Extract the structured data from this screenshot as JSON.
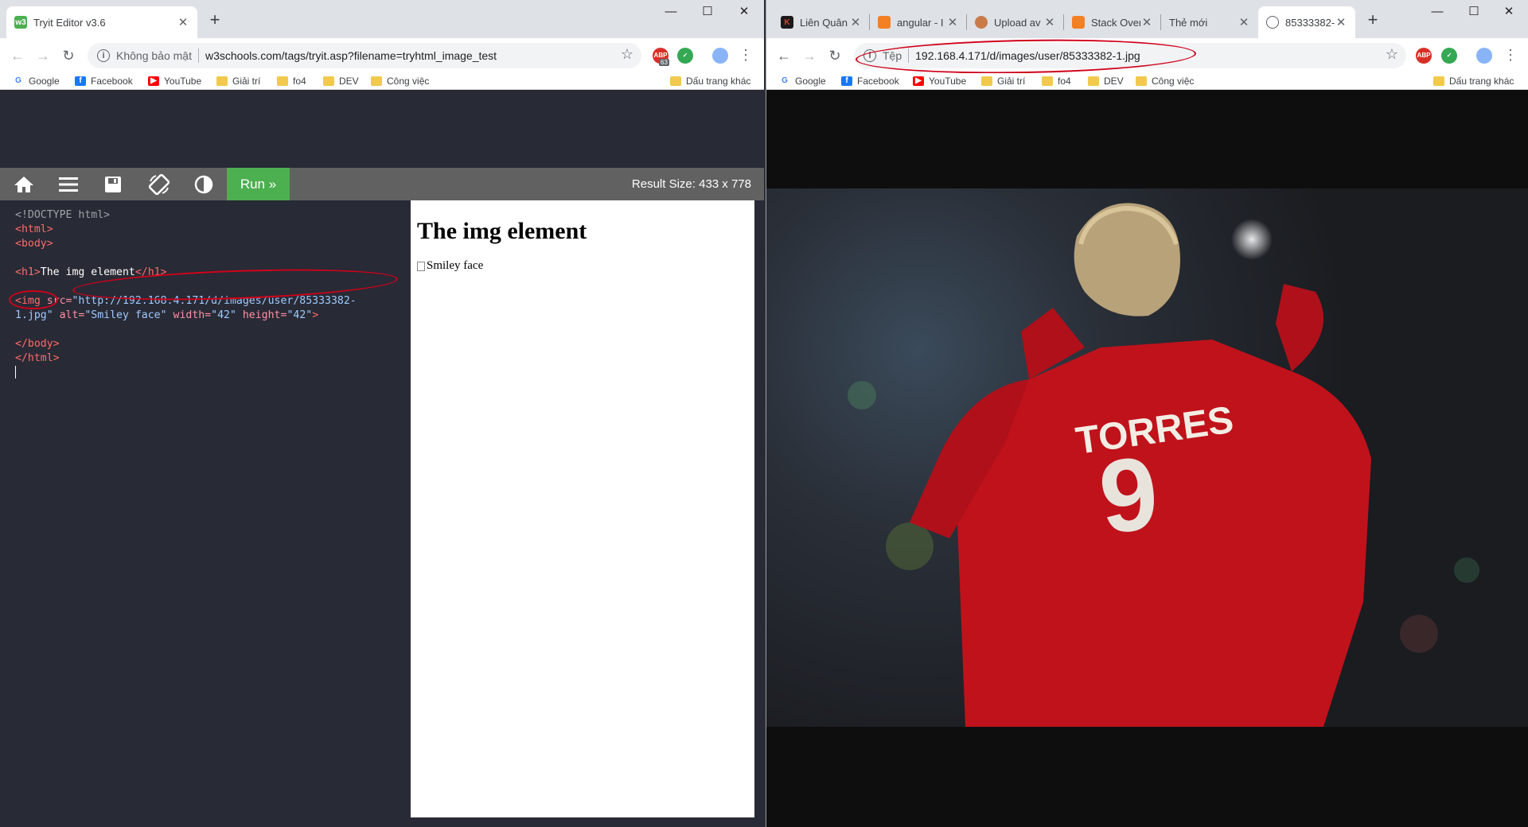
{
  "left": {
    "tab_title": "Tryit Editor v3.6",
    "tab_favicon": "w3",
    "address": {
      "security": "Không bảo mật",
      "url": "w3schools.com/tags/tryit.asp?filename=tryhtml_image_test"
    },
    "ext_badge": "63",
    "bookmarks": [
      "Google",
      "Facebook",
      "YouTube",
      "Giải trí",
      "fo4",
      "DEV",
      "Công việc"
    ],
    "other_bookmarks": "Dấu trang khác",
    "tryit": {
      "run_label": "Run »",
      "result_size_label": "Result Size: 433  x  778",
      "code": {
        "l1": "<!DOCTYPE html>",
        "l2": "<html>",
        "l3": "<body>",
        "l5_open": "<h1>",
        "l5_text": "The img element",
        "l5_close": "</h1>",
        "l7_tag": "<img",
        "l7_attr_src": " src=",
        "l7_val_src": "\"http://192.168.4.171/d/images/user/85333382-",
        "l8_val_src": "1.jpg\"",
        "l8_attr_alt": " alt=",
        "l8_val_alt": "\"Smiley face\"",
        "l8_attr_w": " width=",
        "l8_val_w": "\"42\"",
        "l8_attr_h": " height=",
        "l8_val_h": "\"42\"",
        "l8_close": ">",
        "l10": "</body>",
        "l11": "</html>"
      },
      "result_heading": "The img element",
      "result_alt": "Smiley face"
    }
  },
  "right": {
    "tabs": [
      "Liên Quân",
      "angular - I",
      "Upload av",
      "Stack Over",
      "Thẻ mới",
      "85333382-"
    ],
    "address": {
      "security": "Tệp",
      "url": "192.168.4.171/d/images/user/85333382-1.jpg"
    },
    "bookmarks": [
      "Google",
      "Facebook",
      "YouTube",
      "Giải trí",
      "fo4",
      "DEV",
      "Công việc"
    ],
    "other_bookmarks": "Dấu trang khác",
    "photo": {
      "jersey_name": "TORRES",
      "jersey_number": "9"
    }
  },
  "colors": {
    "run_green": "#4caf50",
    "annotation_red": "#d0021b",
    "jersey_red": "#c0121b"
  }
}
